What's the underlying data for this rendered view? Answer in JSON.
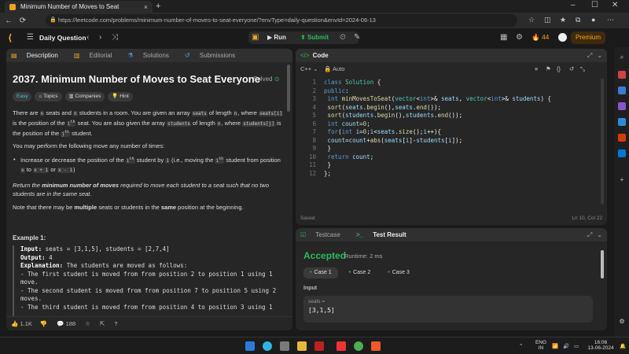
{
  "browser": {
    "tab_title": "Minimum Number of Moves to Seat",
    "tab_close": "×",
    "new_tab": "+",
    "url": "https://leetcode.com/problems/minimum-number-of-moves-to-seat-everyone/?envType=daily-question&envId=2024-06-13"
  },
  "topbar": {
    "daily_question": "Daily Question",
    "run": "Run",
    "submit": "Submit",
    "streak": "44",
    "premium": "Premium"
  },
  "left": {
    "tabs": [
      "Description",
      "Editorial",
      "Solutions",
      "Submissions"
    ],
    "title": "2037. Minimum Number of Moves to Seat Everyone",
    "solved": "Solved",
    "tags": [
      "Easy",
      "Topics",
      "Companies",
      "Hint"
    ],
    "p1a": "There are",
    "p1_n1": "n",
    "p1b": "seats and",
    "p1_n2": "n",
    "p1c": "students in a room. You are given an array",
    "p1_seats": "seats",
    "p1d": "of length",
    "p1_n3": "n",
    "p1e": ", where",
    "p1_seatsi": "seats[i]",
    "p1f": "is the position of the",
    "p1_ith": "i",
    "p1_th": "th",
    "p1g": "seat. You are also given the array",
    "p1_students": "students",
    "p1h": "of length",
    "p1_n4": "n",
    "p1i": ", where",
    "p1_studj": "students[j]",
    "p1j": "is the position of the",
    "p1_jth": "j",
    "p1_th2": "th",
    "p1k": "student.",
    "p2": "You may perform the following move any number of times:",
    "bullet_a": "Increase or decrease the position of the",
    "bullet_ith": "i",
    "bullet_th": "th",
    "bullet_b": "student by",
    "bullet_one": "1",
    "bullet_c": "(i.e., moving the",
    "bullet_ith2": "i",
    "bullet_th2": "th",
    "bullet_d": "student from position",
    "bullet_x": "x",
    "bullet_to": "to",
    "bullet_x1": "x + 1",
    "bullet_or": "or",
    "bullet_x2": "x - 1",
    "bullet_end": ")",
    "p3a": "Return the",
    "p3b": "minimum number of moves",
    "p3c": "required to move each student to a seat such that no two students are in the same seat.",
    "p4a": "Note that there may be",
    "p4b": "multiple",
    "p4c": "seats or students in the",
    "p4d": "same",
    "p4e": "position at the beginning.",
    "example_title": "Example 1:",
    "ex_input_lbl": "Input:",
    "ex_input": "seats = [3,1,5], students = [2,7,4]",
    "ex_output_lbl": "Output:",
    "ex_output": "4",
    "ex_expl_lbl": "Explanation:",
    "ex_expl": "The students are moved as follows:",
    "ex_l1": "- The first student is moved from from position 2 to position 1 using 1",
    "ex_l1b": "move.",
    "ex_l2": "- The second student is moved from from position 7 to position 5 using 2",
    "ex_l2b": "moves.",
    "ex_l3": "- The third student is moved from from position 4 to position 3 using 1",
    "likes": "1.1K",
    "comments": "188"
  },
  "code": {
    "header": "Code",
    "language": "C++",
    "auto": "Auto",
    "status_left": "Saved",
    "status_right": "Ln 10, Col 22",
    "lines": [
      "class Solution {",
      "public:",
      "    int minMovesToSeat(vector<int>& seats, vector<int>& students) {",
      "        sort(seats.begin(),seats.end());",
      "        sort(students.begin(),students.end());",
      "        int count=0;",
      "        for(int i=0;i<seats.size();i++){",
      "            count=count+abs(seats[i]-students[i]);",
      "        }",
      "        return count;",
      "    }",
      "};"
    ]
  },
  "test": {
    "tab1": "Testcase",
    "tab2": "Test Result",
    "status": "Accepted",
    "runtime": "Runtime: 2 ms",
    "cases": [
      "Case 1",
      "Case 2",
      "Case 3"
    ],
    "input_label": "Input",
    "input_name": "seats =",
    "input_value": "[3,1,5]"
  },
  "taskbar": {
    "lang1": "ENG",
    "lang2": "IN",
    "time": "16:06",
    "date": "13-06-2024"
  }
}
